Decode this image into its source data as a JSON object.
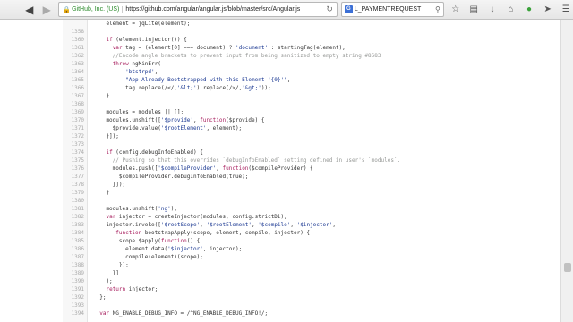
{
  "browser": {
    "url_identity": "GitHub, Inc. (US)",
    "url": "https://github.com/angular/angular.js/blob/master/src/Angular.js",
    "search_query": "L_PAYMENTREQUEST",
    "search_engine_letter": "G"
  },
  "code": {
    "lines": [
      {
        "n": "",
        "t": "    element = jqLite(element);"
      },
      {
        "n": "1358",
        "t": ""
      },
      {
        "n": "1360",
        "t": "    if (element.injector()) {"
      },
      {
        "n": "1361",
        "t": "      var tag = (element[0] === document) ? 'document' : startingTag(element);"
      },
      {
        "n": "1362",
        "t": "      //Encode angle brackets to prevent input from being sanitized to empty string #8683"
      },
      {
        "n": "1363",
        "t": "      throw ngMinErr("
      },
      {
        "n": "1364",
        "t": "          'btstrpd',"
      },
      {
        "n": "1365",
        "t": "          \"App Already Bootstrapped with this Element '{0}'\","
      },
      {
        "n": "1366",
        "t": "          tag.replace(/</,'&lt;').replace(/>/,'&gt;'));"
      },
      {
        "n": "1367",
        "t": "    }"
      },
      {
        "n": "1368",
        "t": ""
      },
      {
        "n": "1369",
        "t": "    modules = modules || [];"
      },
      {
        "n": "1370",
        "t": "    modules.unshift(['$provide', function($provide) {"
      },
      {
        "n": "1371",
        "t": "      $provide.value('$rootElement', element);"
      },
      {
        "n": "1372",
        "t": "    }]);"
      },
      {
        "n": "1373",
        "t": ""
      },
      {
        "n": "1374",
        "t": "    if (config.debugInfoEnabled) {"
      },
      {
        "n": "1375",
        "t": "      // Pushing so that this overrides `debugInfoEnabled` setting defined in user's `modules`."
      },
      {
        "n": "1376",
        "t": "      modules.push(['$compileProvider', function($compileProvider) {"
      },
      {
        "n": "1377",
        "t": "        $compileProvider.debugInfoEnabled(true);"
      },
      {
        "n": "1378",
        "t": "      }]);"
      },
      {
        "n": "1379",
        "t": "    }"
      },
      {
        "n": "1380",
        "t": ""
      },
      {
        "n": "1381",
        "t": "    modules.unshift('ng');"
      },
      {
        "n": "1382",
        "t": "    var injector = createInjector(modules, config.strictDi);"
      },
      {
        "n": "1383",
        "t": "    injector.invoke(['$rootScope', '$rootElement', '$compile', '$injector',"
      },
      {
        "n": "1384",
        "t": "       function bootstrapApply(scope, element, compile, injector) {"
      },
      {
        "n": "1385",
        "t": "        scope.$apply(function() {"
      },
      {
        "n": "1386",
        "t": "          element.data('$injector', injector);"
      },
      {
        "n": "1387",
        "t": "          compile(element)(scope);"
      },
      {
        "n": "1388",
        "t": "        });"
      },
      {
        "n": "1389",
        "t": "      }]"
      },
      {
        "n": "1390",
        "t": "    );"
      },
      {
        "n": "1391",
        "t": "    return injector;"
      },
      {
        "n": "1392",
        "t": "  };"
      },
      {
        "n": "1393",
        "t": ""
      },
      {
        "n": "1394",
        "t": "  var NG_ENABLE_DEBUG_INFO = /^NG_ENABLE_DEBUG_INFO!/;"
      }
    ]
  },
  "colors": {
    "keyword": "#a71d5d",
    "string": "#183691",
    "comment": "#969896"
  }
}
